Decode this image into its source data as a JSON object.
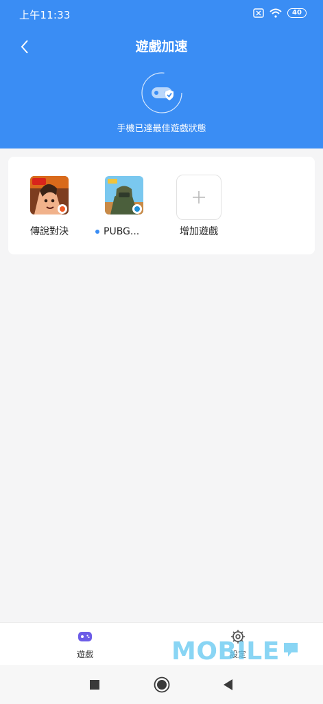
{
  "status_bar": {
    "time": "上午11:33",
    "battery": "40"
  },
  "header": {
    "title": "遊戲加速",
    "status_message": "手機已達最佳遊戲狀態"
  },
  "games": [
    {
      "label": "傳說對決",
      "icon": "game-icon-arena-of-valor"
    },
    {
      "label": "PUBG...",
      "icon": "game-icon-pubg",
      "status_dot": true
    }
  ],
  "add_game": {
    "label": "增加遊戲"
  },
  "tabs": {
    "games": {
      "label": "遊戲",
      "icon": "gamepad-icon"
    },
    "settings": {
      "label": "設定",
      "icon": "gear-icon"
    }
  },
  "watermark": {
    "text": "MOBILE"
  },
  "colors": {
    "accent": "#3a8df4",
    "tab_active_icon": "#6c5ce7",
    "watermark": "#5cc6f1"
  }
}
